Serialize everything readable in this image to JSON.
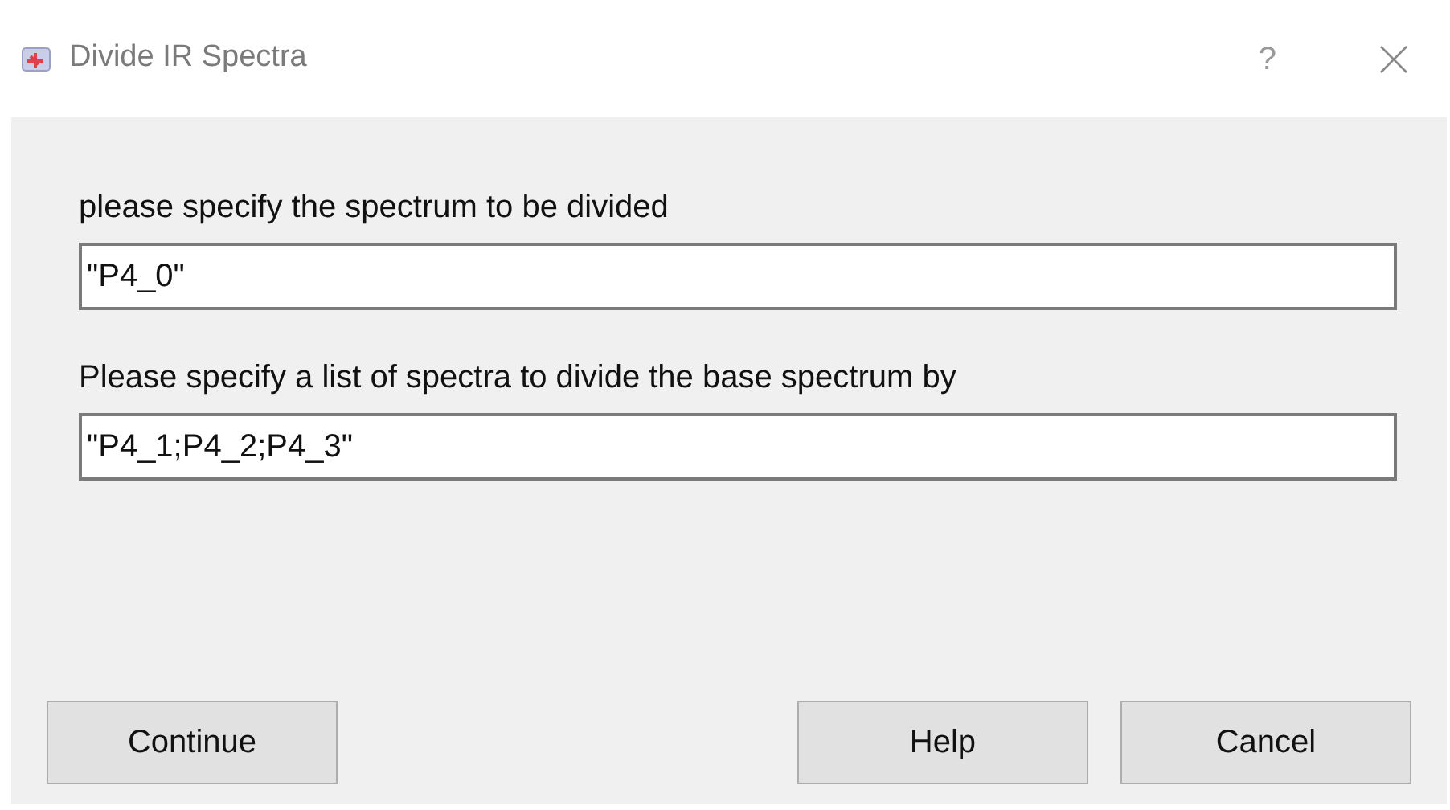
{
  "window": {
    "title": "Divide IR Spectra",
    "help": "?"
  },
  "fields": [
    {
      "label": "please specify the spectrum to be divided",
      "value": "\"P4_0\""
    },
    {
      "label": "Please specify a list of spectra to divide the base spectrum by",
      "value": "\"P4_1;P4_2;P4_3\""
    }
  ],
  "left_buttons": [
    "Continue"
  ],
  "right_buttons": [
    "Help",
    "Cancel"
  ]
}
